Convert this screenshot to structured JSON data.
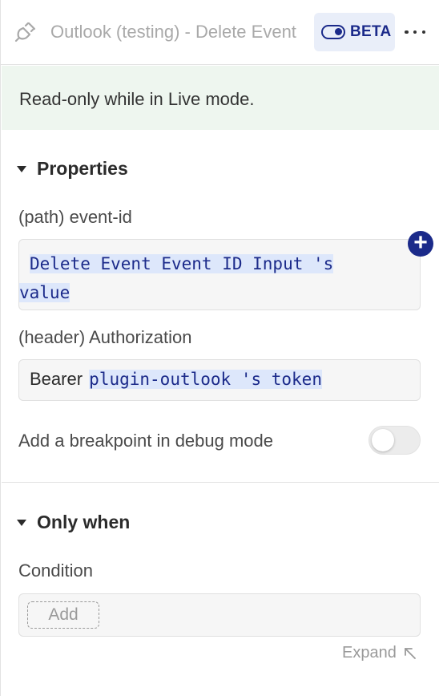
{
  "header": {
    "plugin_icon": "plug-icon",
    "title": "Outlook (testing) - Delete Event",
    "beta_label": "BETA",
    "beta_icon": "toggle-icon",
    "more_icon": "more-horizontal-icon"
  },
  "notice": {
    "text": "Read-only while in Live mode."
  },
  "properties": {
    "title": "Properties",
    "path_label": "(path) event-id",
    "path_value_line1": "Delete Event Event ID Input 's",
    "path_value_line2": "value",
    "header_label": "(header) Authorization",
    "header_prefix": "Bearer",
    "header_value": "plugin-outlook 's token",
    "breakpoint_label": "Add a breakpoint in debug mode",
    "breakpoint_enabled": false,
    "add_dynamic_icon": "plus-circle-icon"
  },
  "only_when": {
    "title": "Only when",
    "condition_label": "Condition",
    "add_label": "Add",
    "expand_label": "Expand"
  },
  "colors": {
    "accent": "#1b2a8a",
    "highlight": "#dde7fb",
    "notice_bg": "#eef6ef"
  }
}
